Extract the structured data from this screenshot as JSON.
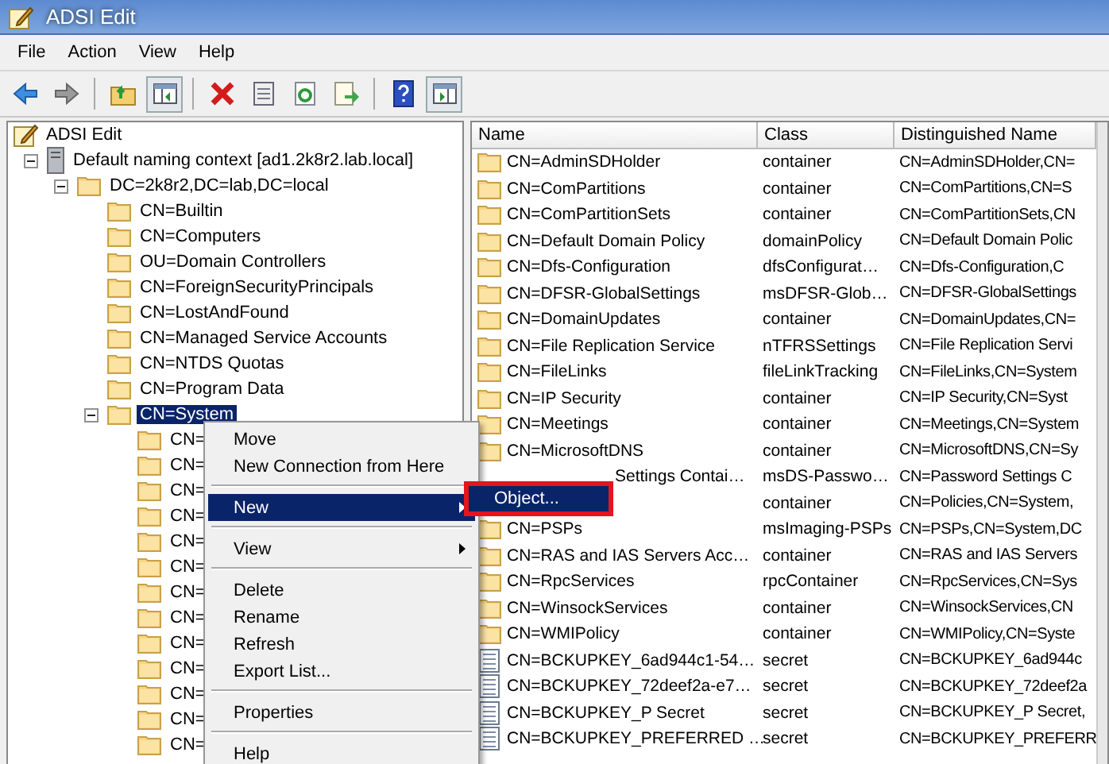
{
  "window": {
    "title": "ADSI Edit"
  },
  "menu_bar": [
    {
      "label": "File"
    },
    {
      "label": "Action"
    },
    {
      "label": "View"
    },
    {
      "label": "Help"
    }
  ],
  "toolbar": [
    {
      "kind": "back",
      "pressed": false
    },
    {
      "kind": "forward",
      "pressed": false
    },
    {
      "kind": "separator"
    },
    {
      "kind": "up",
      "pressed": false
    },
    {
      "kind": "tree-toggle",
      "pressed": true
    },
    {
      "kind": "separator"
    },
    {
      "kind": "delete",
      "pressed": false
    },
    {
      "kind": "properties",
      "pressed": false
    },
    {
      "kind": "refresh",
      "pressed": false
    },
    {
      "kind": "export",
      "pressed": false
    },
    {
      "kind": "separator"
    },
    {
      "kind": "help",
      "pressed": false
    },
    {
      "kind": "action-pane",
      "pressed": true
    }
  ],
  "tree": {
    "root": "ADSI Edit",
    "children": [
      {
        "label": "Default naming context [ad1.2k8r2.lab.local]",
        "kind": "server",
        "selected": false,
        "expanded": true,
        "children": [
          {
            "label": "DC=2k8r2,DC=lab,DC=local",
            "kind": "folder",
            "selected": false,
            "expanded": true,
            "children": [
              {
                "label": "CN=Builtin",
                "kind": "folder",
                "selected": false
              },
              {
                "label": "CN=Computers",
                "kind": "folder",
                "selected": false
              },
              {
                "label": "OU=Domain Controllers",
                "kind": "folder",
                "selected": false
              },
              {
                "label": "CN=ForeignSecurityPrincipals",
                "kind": "folder",
                "selected": false
              },
              {
                "label": "CN=LostAndFound",
                "kind": "folder",
                "selected": false
              },
              {
                "label": "CN=Managed Service Accounts",
                "kind": "folder",
                "selected": false
              },
              {
                "label": "CN=NTDS Quotas",
                "kind": "folder",
                "selected": false
              },
              {
                "label": "CN=Program Data",
                "kind": "folder",
                "selected": false
              },
              {
                "label": "CN=System",
                "kind": "folder",
                "selected": true,
                "expanded": true,
                "children": [
                  {
                    "label": "CN=",
                    "kind": "folder",
                    "selected": false
                  },
                  {
                    "label": "CN=",
                    "kind": "folder",
                    "selected": false
                  },
                  {
                    "label": "CN=",
                    "kind": "folder",
                    "selected": false
                  },
                  {
                    "label": "CN=",
                    "kind": "folder",
                    "selected": false
                  },
                  {
                    "label": "CN=",
                    "kind": "folder",
                    "selected": false
                  },
                  {
                    "label": "CN=",
                    "kind": "folder",
                    "selected": false
                  },
                  {
                    "label": "CN=",
                    "kind": "folder",
                    "selected": false
                  },
                  {
                    "label": "CN=",
                    "kind": "folder",
                    "selected": false
                  },
                  {
                    "label": "CN=",
                    "kind": "folder",
                    "selected": false
                  },
                  {
                    "label": "CN=",
                    "kind": "folder",
                    "selected": false
                  },
                  {
                    "label": "CN=",
                    "kind": "folder",
                    "selected": false
                  },
                  {
                    "label": "CN=",
                    "kind": "folder",
                    "selected": false
                  },
                  {
                    "label": "CN=",
                    "kind": "folder",
                    "selected": false
                  }
                ]
              }
            ]
          }
        ]
      }
    ]
  },
  "table": {
    "columns": [
      "Name",
      "Class",
      "Distinguished Name"
    ],
    "rows": [
      {
        "kind": "folder",
        "name": "CN=AdminSDHolder",
        "class": "container",
        "dn": "CN=AdminSDHolder,CN="
      },
      {
        "kind": "folder",
        "name": "CN=ComPartitions",
        "class": "container",
        "dn": "CN=ComPartitions,CN=S"
      },
      {
        "kind": "folder",
        "name": "CN=ComPartitionSets",
        "class": "container",
        "dn": "CN=ComPartitionSets,CN"
      },
      {
        "kind": "folder",
        "name": "CN=Default Domain Policy",
        "class": "domainPolicy",
        "dn": "CN=Default Domain Polic"
      },
      {
        "kind": "folder",
        "name": "CN=Dfs-Configuration",
        "class": "dfsConfigurat…",
        "dn": "CN=Dfs-Configuration,C"
      },
      {
        "kind": "folder",
        "name": "CN=DFSR-GlobalSettings",
        "class": "msDFSR-Glob…",
        "dn": "CN=DFSR-GlobalSettings"
      },
      {
        "kind": "folder",
        "name": "CN=DomainUpdates",
        "class": "container",
        "dn": "CN=DomainUpdates,CN="
      },
      {
        "kind": "folder",
        "name": "CN=File Replication Service",
        "class": "nTFRSSettings",
        "dn": "CN=File Replication Servi"
      },
      {
        "kind": "folder",
        "name": "CN=FileLinks",
        "class": "fileLinkTracking",
        "dn": "CN=FileLinks,CN=System"
      },
      {
        "kind": "folder",
        "name": "CN=IP Security",
        "class": "container",
        "dn": "CN=IP Security,CN=Syst"
      },
      {
        "kind": "folder",
        "name": "CN=Meetings",
        "class": "container",
        "dn": "CN=Meetings,CN=System"
      },
      {
        "kind": "folder",
        "name": "CN=MicrosoftDNS",
        "class": "container",
        "dn": "CN=MicrosoftDNS,CN=Sy"
      },
      {
        "kind": "covered",
        "name": "Settings Contai…",
        "class": "msDS-Passwo…",
        "dn": "CN=Password Settings C"
      },
      {
        "kind": "covered",
        "class": "container",
        "dn": "CN=Policies,CN=System,"
      },
      {
        "kind": "folder",
        "name": "CN=PSPs",
        "class": "msImaging-PSPs",
        "dn": "CN=PSPs,CN=System,DC"
      },
      {
        "kind": "folder",
        "name": "CN=RAS and IAS Servers Acc…",
        "class": "container",
        "dn": "CN=RAS and IAS Servers"
      },
      {
        "kind": "folder",
        "name": "CN=RpcServices",
        "class": "rpcContainer",
        "dn": "CN=RpcServices,CN=Sys"
      },
      {
        "kind": "folder",
        "name": "CN=WinsockServices",
        "class": "container",
        "dn": "CN=WinsockServices,CN"
      },
      {
        "kind": "folder",
        "name": "CN=WMIPolicy",
        "class": "container",
        "dn": "CN=WMIPolicy,CN=Syste"
      },
      {
        "kind": "secret",
        "name": "CN=BCKUPKEY_6ad944c1-54…",
        "class": "secret",
        "dn": "CN=BCKUPKEY_6ad944c"
      },
      {
        "kind": "secret",
        "name": "CN=BCKUPKEY_72deef2a-e7…",
        "class": "secret",
        "dn": "CN=BCKUPKEY_72deef2a"
      },
      {
        "kind": "secret",
        "name": "CN=BCKUPKEY_P Secret",
        "class": "secret",
        "dn": "CN=BCKUPKEY_P Secret,"
      },
      {
        "kind": "secret",
        "name": "CN=BCKUPKEY_PREFERRED …",
        "class": "secret",
        "dn": "CN=BCKUPKEY_PREFERR"
      }
    ]
  },
  "context_menu": {
    "items": [
      {
        "kind": "item",
        "label": "Move",
        "selected": false
      },
      {
        "kind": "item",
        "label": "New Connection from Here",
        "selected": false
      },
      {
        "kind": "separator"
      },
      {
        "kind": "submenu",
        "label": "New",
        "selected": true
      },
      {
        "kind": "separator"
      },
      {
        "kind": "submenu",
        "label": "View",
        "selected": false
      },
      {
        "kind": "separator"
      },
      {
        "kind": "item",
        "label": "Delete",
        "selected": false
      },
      {
        "kind": "item",
        "label": "Rename",
        "selected": false
      },
      {
        "kind": "item",
        "label": "Refresh",
        "selected": false
      },
      {
        "kind": "item",
        "label": "Export List...",
        "selected": false
      },
      {
        "kind": "separator"
      },
      {
        "kind": "item",
        "label": "Properties",
        "selected": false
      },
      {
        "kind": "separator"
      },
      {
        "kind": "item",
        "label": "Help",
        "selected": false
      }
    ]
  },
  "submenu": {
    "highlight_frame": true,
    "items": [
      {
        "label": "Object...",
        "selected": true
      }
    ]
  }
}
